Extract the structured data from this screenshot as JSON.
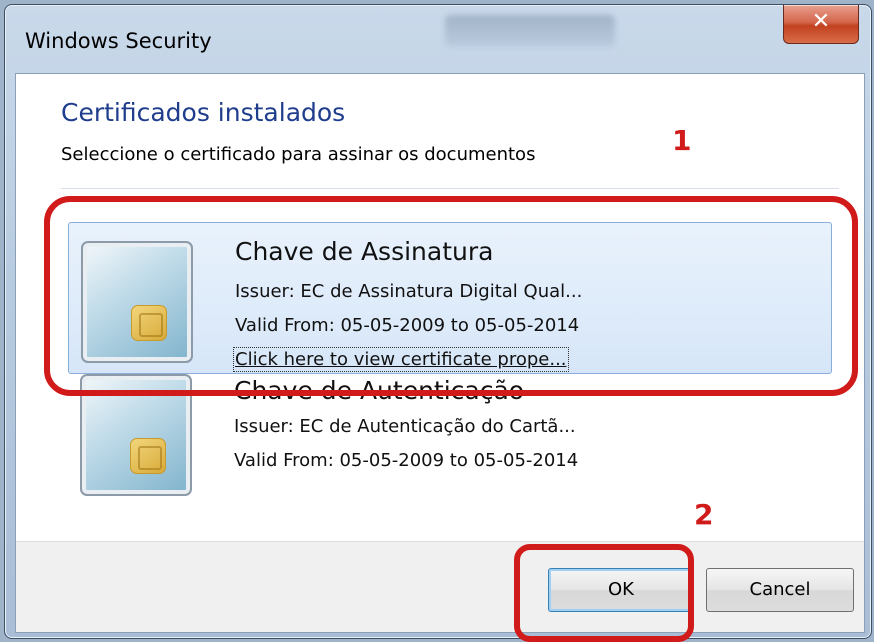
{
  "window": {
    "title": "Windows Security",
    "close_glyph": "✕"
  },
  "dialog": {
    "heading": "Certificados instalados",
    "subheading": "Seleccione o certificado para assinar os documentos"
  },
  "certificates": [
    {
      "name": "Chave de Assinatura",
      "issuer": "Issuer: EC de Assinatura Digital Qual...",
      "valid": "Valid From: 05-05-2009 to 05-05-2014",
      "link": "Click here to view certificate prope...",
      "selected": true,
      "icon": "smart-card-icon"
    },
    {
      "name": "Chave de Autenticação",
      "issuer": "Issuer: EC de Autenticação do Cartã...",
      "valid": "Valid From: 05-05-2009 to 05-05-2014",
      "selected": false,
      "icon": "smart-card-icon"
    }
  ],
  "buttons": {
    "ok": "OK",
    "cancel": "Cancel"
  },
  "annotations": {
    "step1": "1",
    "step2": "2",
    "color": "#d11a1a"
  },
  "colors": {
    "heading": "#1f3d8c",
    "selection": "#d6e6f8",
    "close_button": "#c2411f"
  }
}
